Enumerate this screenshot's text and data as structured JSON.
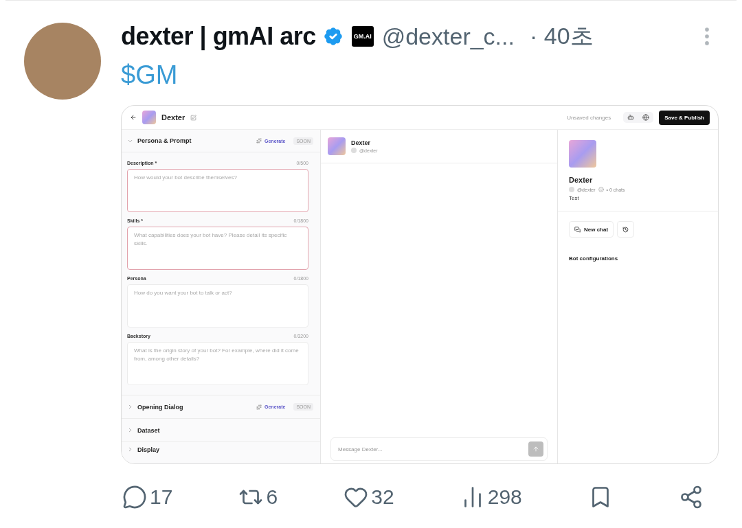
{
  "tweet": {
    "author": "dexter | gmAI arc",
    "verified": true,
    "affiliate_badge": "GM.AI",
    "handle": "@dexter_c...",
    "time": "· 40초",
    "text": "$GM"
  },
  "app": {
    "header": {
      "bot_name": "Dexter",
      "status": "Unsaved changes",
      "publish": "Save & Publish"
    },
    "sections": [
      {
        "title": "Persona & Prompt",
        "expanded": true,
        "generate": "Generate",
        "badge": "SOON",
        "fields": [
          {
            "label": "Description *",
            "count": "0/500",
            "placeholder": "How would your bot describe themselves?",
            "invalid": true
          },
          {
            "label": "Skills *",
            "count": "0/1800",
            "placeholder": "What capabilities does your bot have? Please detail its specific skills.",
            "invalid": true
          },
          {
            "label": "Persona",
            "count": "0/1800",
            "placeholder": "How do you want your bot to talk or act?",
            "invalid": false
          },
          {
            "label": "Backstory",
            "count": "0/3200",
            "placeholder": "What is the origin story of your bot? For example, where did it come from, among other details?",
            "invalid": false
          }
        ]
      },
      {
        "title": "Opening Dialog",
        "expanded": false,
        "generate": "Generate",
        "badge": "SOON"
      },
      {
        "title": "Dataset",
        "expanded": false
      },
      {
        "title": "Display",
        "expanded": false
      }
    ],
    "chat": {
      "name": "Dexter",
      "handle": "@dexter",
      "placeholder": "Message Dexter..."
    },
    "profile": {
      "name": "Dexter",
      "handle": "@dexter",
      "chats": "• 0 chats",
      "description": "Test",
      "new_chat": "New chat",
      "configurations": "Bot configurations"
    }
  },
  "actions": [
    {
      "kind": "reply",
      "count": "17"
    },
    {
      "kind": "repost",
      "count": "6"
    },
    {
      "kind": "like",
      "count": "32"
    },
    {
      "kind": "views",
      "count": "298"
    },
    {
      "kind": "bookmark"
    },
    {
      "kind": "share"
    }
  ]
}
